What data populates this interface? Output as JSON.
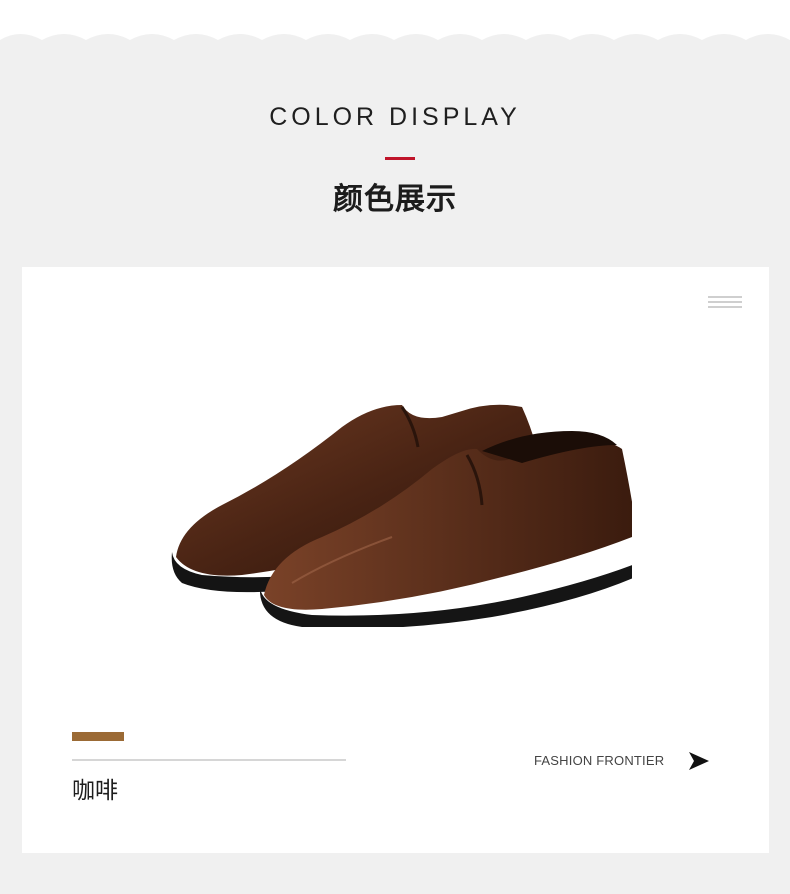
{
  "header": {
    "title_en": "COLOR DISPLAY",
    "title_zh": "颜色展示",
    "accent_color": "#c0142a"
  },
  "product": {
    "image_subject": "brown leather slip-on dress shoes",
    "menu_icon": "menu-lines-icon",
    "swatch_color": "#9b6a35",
    "color_name": "咖啡",
    "tagline": "FASHION FRONTIER",
    "arrow_icon": "arrow-right-icon"
  }
}
